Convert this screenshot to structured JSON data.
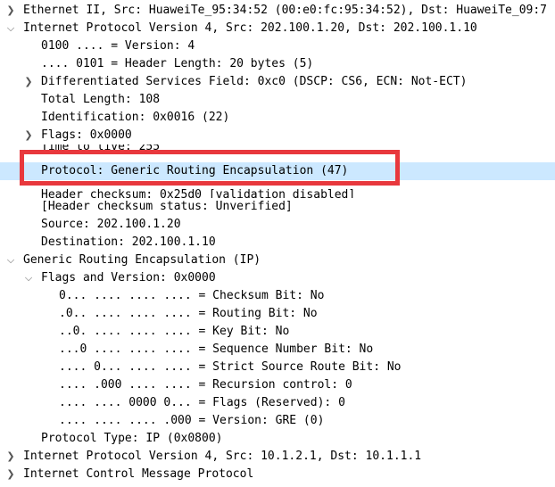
{
  "packet_tree": {
    "rows": [
      {
        "text": "Ethernet II, Src: HuaweiTe_95:34:52 (00:e0:fc:95:34:52), Dst: HuaweiTe_09:7"
      },
      {
        "text": "Internet Protocol Version 4, Src: 202.100.1.20, Dst: 202.100.1.10"
      },
      {
        "text": "0100 .... = Version: 4"
      },
      {
        "text": ".... 0101 = Header Length: 20 bytes (5)"
      },
      {
        "text": "Differentiated Services Field: 0xc0 (DSCP: CS6, ECN: Not-ECT)"
      },
      {
        "text": "Total Length: 108"
      },
      {
        "text": "Identification: 0x0016 (22)"
      },
      {
        "text": "Flags: 0x0000"
      },
      {
        "text": "Time to live: 255"
      },
      {
        "text": "Protocol: Generic Routing Encapsulation (47)"
      },
      {
        "text": "Header checksum: 0x25d0 [validation disabled]"
      },
      {
        "text": "[Header checksum status: Unverified]"
      },
      {
        "text": "Source: 202.100.1.20"
      },
      {
        "text": "Destination: 202.100.1.10"
      },
      {
        "text": "Generic Routing Encapsulation (IP)"
      },
      {
        "text": "Flags and Version: 0x0000"
      },
      {
        "text": "0... .... .... .... = Checksum Bit: No"
      },
      {
        "text": ".0.. .... .... .... = Routing Bit: No"
      },
      {
        "text": "..0. .... .... .... = Key Bit: No"
      },
      {
        "text": "...0 .... .... .... = Sequence Number Bit: No"
      },
      {
        "text": ".... 0... .... .... = Strict Source Route Bit: No"
      },
      {
        "text": ".... .000 .... .... = Recursion control: 0"
      },
      {
        "text": ".... .... 0000 0... = Flags (Reserved): 0"
      },
      {
        "text": ".... .... .... .000 = Version: GRE (0)"
      },
      {
        "text": "Protocol Type: IP (0x0800)"
      },
      {
        "text": "Internet Protocol Version 4, Src: 10.1.2.1, Dst: 10.1.1.1"
      },
      {
        "text": "Internet Control Message Protocol"
      }
    ]
  },
  "icons": {
    "collapsed": "chevron-right-icon",
    "expanded": "chevron-down-icon"
  },
  "colors": {
    "selection_background": "#cce8ff",
    "highlight_box_border": "#e8383d",
    "arrow": "#555555"
  }
}
